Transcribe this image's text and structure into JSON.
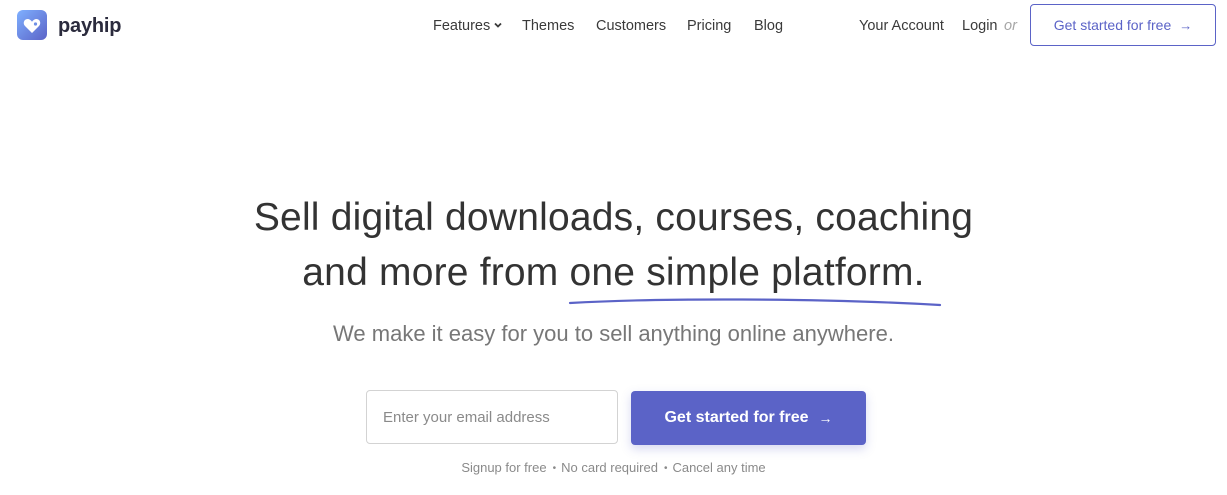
{
  "brand": {
    "name": "payhip",
    "accent": "#5b63c7",
    "logo_icon": "heart-tag-icon"
  },
  "nav": {
    "features": "Features",
    "themes": "Themes",
    "customers": "Customers",
    "pricing": "Pricing",
    "blog": "Blog",
    "your_account": "Your Account",
    "login": "Login",
    "or": "or",
    "cta": "Get started for free",
    "cta_icon": "arrow-right-icon",
    "features_icon": "chevron-down-icon"
  },
  "hero": {
    "headline_line1": "Sell digital downloads, courses, coaching",
    "headline_line2_start": "and more from ",
    "headline_highlight": "one simple platform",
    "headline_end": ".",
    "subhead": "We make it easy for you to sell anything online anywhere.",
    "email_placeholder": "Enter your email address",
    "cta": "Get started for free",
    "fineprint": [
      "Signup for free",
      "No card required",
      "Cancel any time"
    ]
  }
}
